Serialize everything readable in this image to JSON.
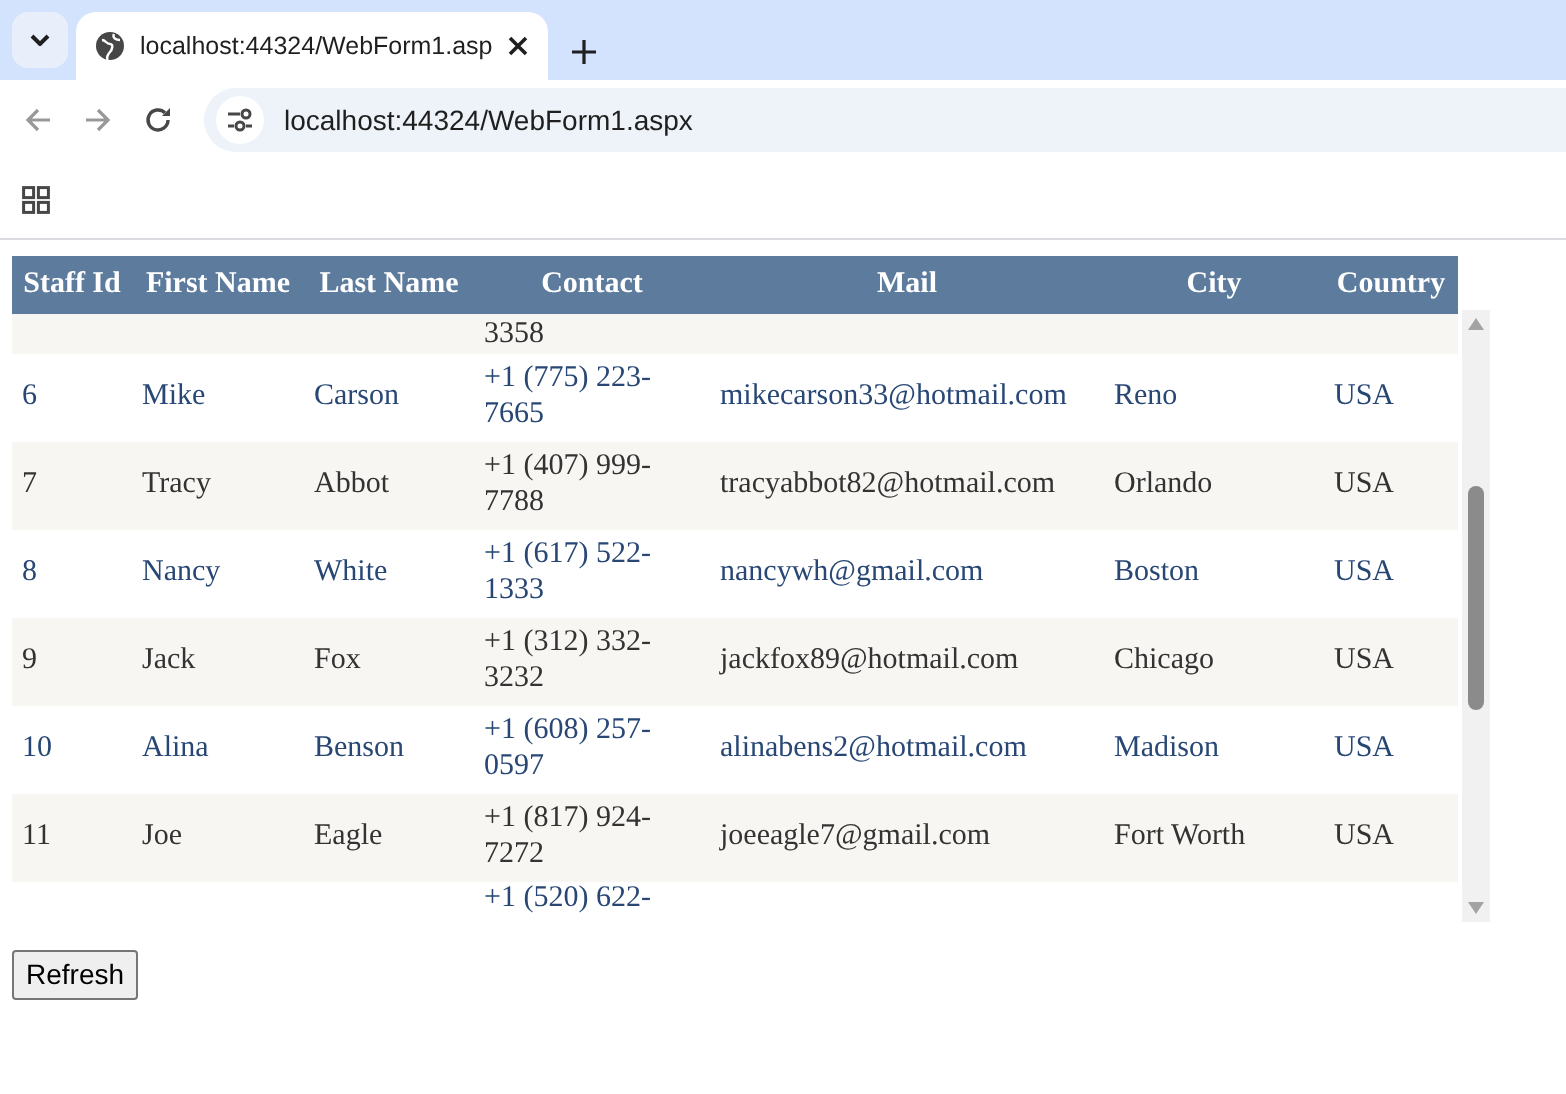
{
  "browser": {
    "tab_title": "localhost:44324/WebForm1.asp",
    "address": "localhost:44324/WebForm1.aspx"
  },
  "table": {
    "columns": [
      "Staff Id",
      "First Name",
      "Last Name",
      "Contact",
      "Mail",
      "City",
      "Country"
    ],
    "rows": [
      {
        "kind": "partial",
        "contact": "3358"
      },
      {
        "kind": "full",
        "staff_id": "6",
        "first_name": "Mike",
        "last_name": "Carson",
        "contact": "+1 (775) 223-7665",
        "mail": "mikecarson33@hotmail.com",
        "city": "Reno",
        "country": "USA"
      },
      {
        "kind": "full",
        "staff_id": "7",
        "first_name": "Tracy",
        "last_name": "Abbot",
        "contact": "+1 (407) 999-7788",
        "mail": "tracyabbot82@hotmail.com",
        "city": "Orlando",
        "country": "USA"
      },
      {
        "kind": "full",
        "staff_id": "8",
        "first_name": "Nancy",
        "last_name": "White",
        "contact": "+1 (617) 522-1333",
        "mail": "nancywh@gmail.com",
        "city": "Boston",
        "country": "USA"
      },
      {
        "kind": "full",
        "staff_id": "9",
        "first_name": "Jack",
        "last_name": "Fox",
        "contact": "+1 (312) 332-3232",
        "mail": "jackfox89@hotmail.com",
        "city": "Chicago",
        "country": "USA"
      },
      {
        "kind": "full",
        "staff_id": "10",
        "first_name": "Alina",
        "last_name": "Benson",
        "contact": "+1 (608) 257-0597",
        "mail": "alinabens2@hotmail.com",
        "city": "Madison",
        "country": "USA"
      },
      {
        "kind": "full",
        "staff_id": "11",
        "first_name": "Joe",
        "last_name": "Eagle",
        "contact": "+1 (817) 924-7272",
        "mail": "joeeagle7@gmail.com",
        "city": "Fort Worth",
        "country": "USA"
      },
      {
        "kind": "partial",
        "contact": "+1 (520) 622-"
      }
    ]
  },
  "refresh_button": "Refresh"
}
